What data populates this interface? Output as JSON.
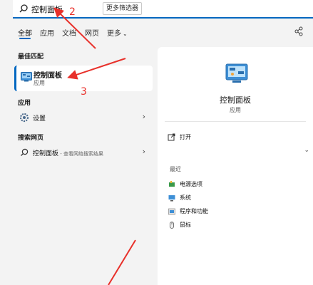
{
  "search": {
    "query": "控制面板",
    "more_filters": "更多筛选器"
  },
  "tabs": [
    {
      "label": "全部",
      "active": true
    },
    {
      "label": "应用"
    },
    {
      "label": "文档"
    },
    {
      "label": "网页"
    },
    {
      "label": "更多"
    }
  ],
  "left": {
    "best_match_header": "最佳匹配",
    "best_match": {
      "title": "控制面板",
      "subtitle": "应用",
      "icon": "control-panel-icon"
    },
    "apps_header": "应用",
    "apps": [
      {
        "label": "设置",
        "icon": "gear-icon"
      }
    ],
    "web_header": "搜索网页",
    "web": [
      {
        "label": "控制面板",
        "suffix": " - 查看网络搜索结果",
        "icon": "search-icon"
      }
    ]
  },
  "right": {
    "title": "控制面板",
    "subtitle": "应用",
    "open_label": "打开",
    "recent_header": "最近",
    "recent": [
      {
        "label": "电源选项",
        "icon": "power-options-icon"
      },
      {
        "label": "系统",
        "icon": "system-icon"
      },
      {
        "label": "程序和功能",
        "icon": "programs-icon"
      },
      {
        "label": "鼠标",
        "icon": "mouse-icon"
      }
    ]
  },
  "annotations": {
    "step2": "2",
    "step3": "3"
  },
  "colors": {
    "accent": "#0067c0",
    "annotation": "#e8302a",
    "panel_bg": "#ffffff",
    "page_bg": "#f3f3f3"
  }
}
